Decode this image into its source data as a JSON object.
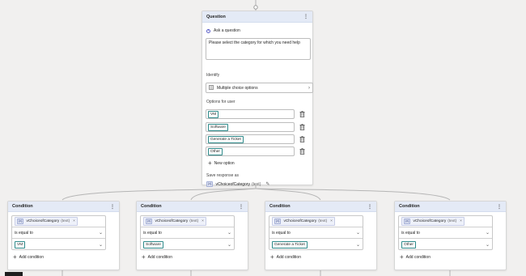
{
  "question_node": {
    "title": "Question",
    "menu_glyph": "⋮",
    "ask_label": "Ask a question",
    "question_text": "Please select the category for which you need help",
    "identify_label": "Identify",
    "identify_value": "Multiple choice options",
    "options_label": "Options for user",
    "options": [
      "VM",
      "Software",
      "Generate a Ticket",
      "Other"
    ],
    "new_option_label": "New option",
    "save_response_label": "Save response as",
    "variable_name": "vChoiceofCategory",
    "variable_type": "(text)",
    "variable_icon": "{x}"
  },
  "condition_nodes": [
    {
      "title": "Condition",
      "variable": "vChoiceofCategory",
      "variable_type": "(text)",
      "operator": "is equal to",
      "value": "VM",
      "add_condition_label": "Add condition"
    },
    {
      "title": "Condition",
      "variable": "vChoiceofCategory",
      "variable_type": "(text)",
      "operator": "is equal to",
      "value": "Software",
      "add_condition_label": "Add condition"
    },
    {
      "title": "Condition",
      "variable": "vChoiceofCategory",
      "variable_type": "(text)",
      "operator": "is equal to",
      "value": "Generate a Ticket",
      "add_condition_label": "Add condition"
    },
    {
      "title": "Condition",
      "variable": "vChoiceofCategory",
      "variable_type": "(text)",
      "operator": "is equal to",
      "value": "Other",
      "add_condition_label": "Add condition"
    }
  ],
  "icons": {
    "menu": "kebab-icon",
    "multiple_choice": "list-icon",
    "chevron": "chevron-right-icon",
    "trash": "trash-icon",
    "add": "plus-icon",
    "edit": "pencil-icon",
    "clear": "close-icon",
    "dropdown": "chevron-down-icon"
  },
  "colors": {
    "canvas": "#f1f0ef",
    "header": "#e4eaf6",
    "accent": "#5b5fc7",
    "chip_border": "#2f8a8a",
    "connector": "#b5b5b5"
  }
}
